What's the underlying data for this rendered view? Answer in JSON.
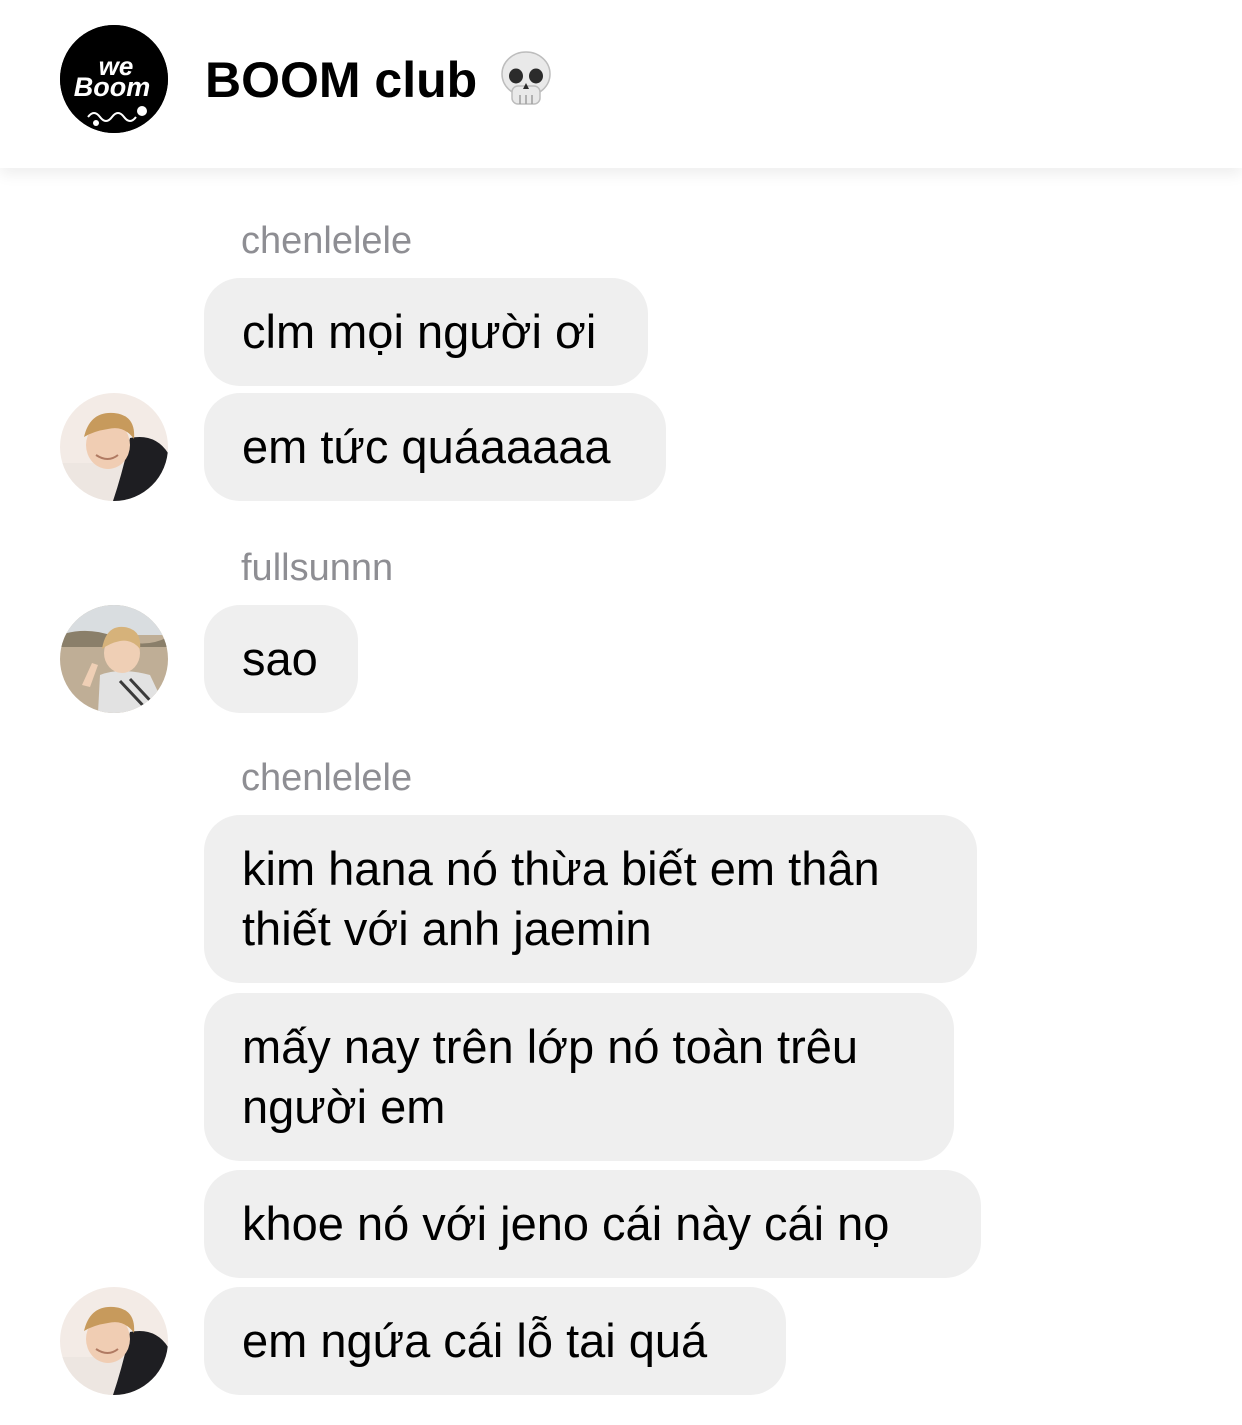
{
  "header": {
    "title": "BOOM club",
    "title_emoji": "skull-icon",
    "logo_text_top": "we",
    "logo_text_bottom": "Boom"
  },
  "messages": [
    {
      "sender": "chenlelele",
      "bubbles": [
        "clm mọi người ơi",
        "em tức quáaaaaa"
      ]
    },
    {
      "sender": "fullsunnn",
      "bubbles": [
        "sao"
      ]
    },
    {
      "sender": "chenlelele",
      "bubbles": [
        "kim hana nó thừa biết em thân thiết với anh jaemin",
        "mấy nay trên lớp nó toàn trêu người em",
        "khoe nó với jeno cái này cái nọ",
        "em ngứa cái lỗ tai quá"
      ]
    }
  ],
  "colors": {
    "bubble_bg": "#efefef",
    "sender_name": "#8e8e93",
    "header_bg": "#ffffff"
  }
}
